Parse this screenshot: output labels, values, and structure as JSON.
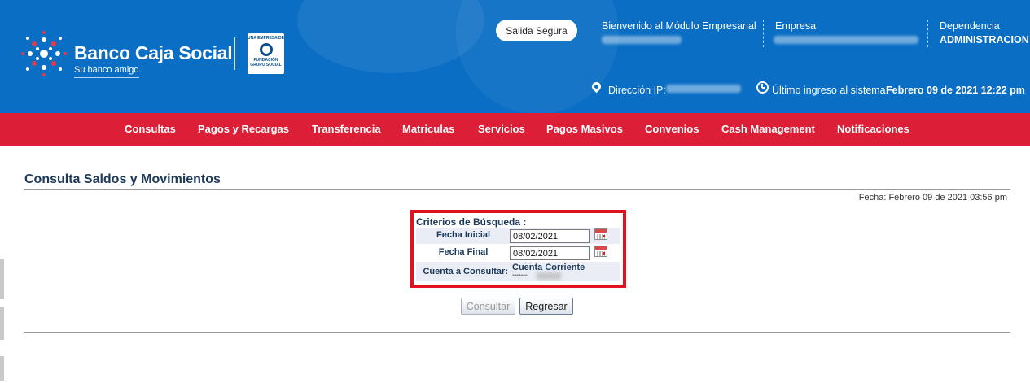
{
  "header": {
    "brand_name": "Banco Caja Social",
    "slogan": "Su banco amigo.",
    "foundation": {
      "top": "UNA EMPRESA DE",
      "line1": "FUNDACIÓN",
      "line2": "GRUPO SOCIAL"
    },
    "secure_exit_label": "Salida Segura",
    "welcome_label": "Bienvenido al Módulo Empresarial",
    "company_label": "Empresa",
    "dependency_label": "Dependencia",
    "dependency_value": "ADMINISTRACION",
    "ip_label": "Dirección IP:",
    "last_login_label": "Último ingreso al sistema:",
    "last_login_value": "Febrero 09 de 2021 12:22 pm"
  },
  "nav": {
    "items": [
      "Consultas",
      "Pagos y Recargas",
      "Transferencia",
      "Matriculas",
      "Servicios",
      "Pagos Masivos",
      "Convenios",
      "Cash Management",
      "Notificaciones"
    ]
  },
  "page": {
    "title": "Consulta Saldos y Movimientos",
    "date_text": "Fecha: Febrero 09 de 2021 03:56 pm"
  },
  "criteria": {
    "title": "Criterios de Búsqueda :",
    "start_date_label": "Fecha Inicial",
    "start_date_value": "08/02/2021",
    "end_date_label": "Fecha Final",
    "end_date_value": "08/02/2021",
    "account_label": "Cuenta a Consultar:",
    "account_type": "Cuenta Corriente",
    "account_number_masked": "*******"
  },
  "buttons": {
    "consult_label": "Consultar",
    "back_label": "Regresar"
  },
  "colors": {
    "header_blue": "#0a6ec4",
    "nav_red": "#dc1f36",
    "highlight_red": "#e0121e",
    "title_navy": "#1c3a5a"
  }
}
